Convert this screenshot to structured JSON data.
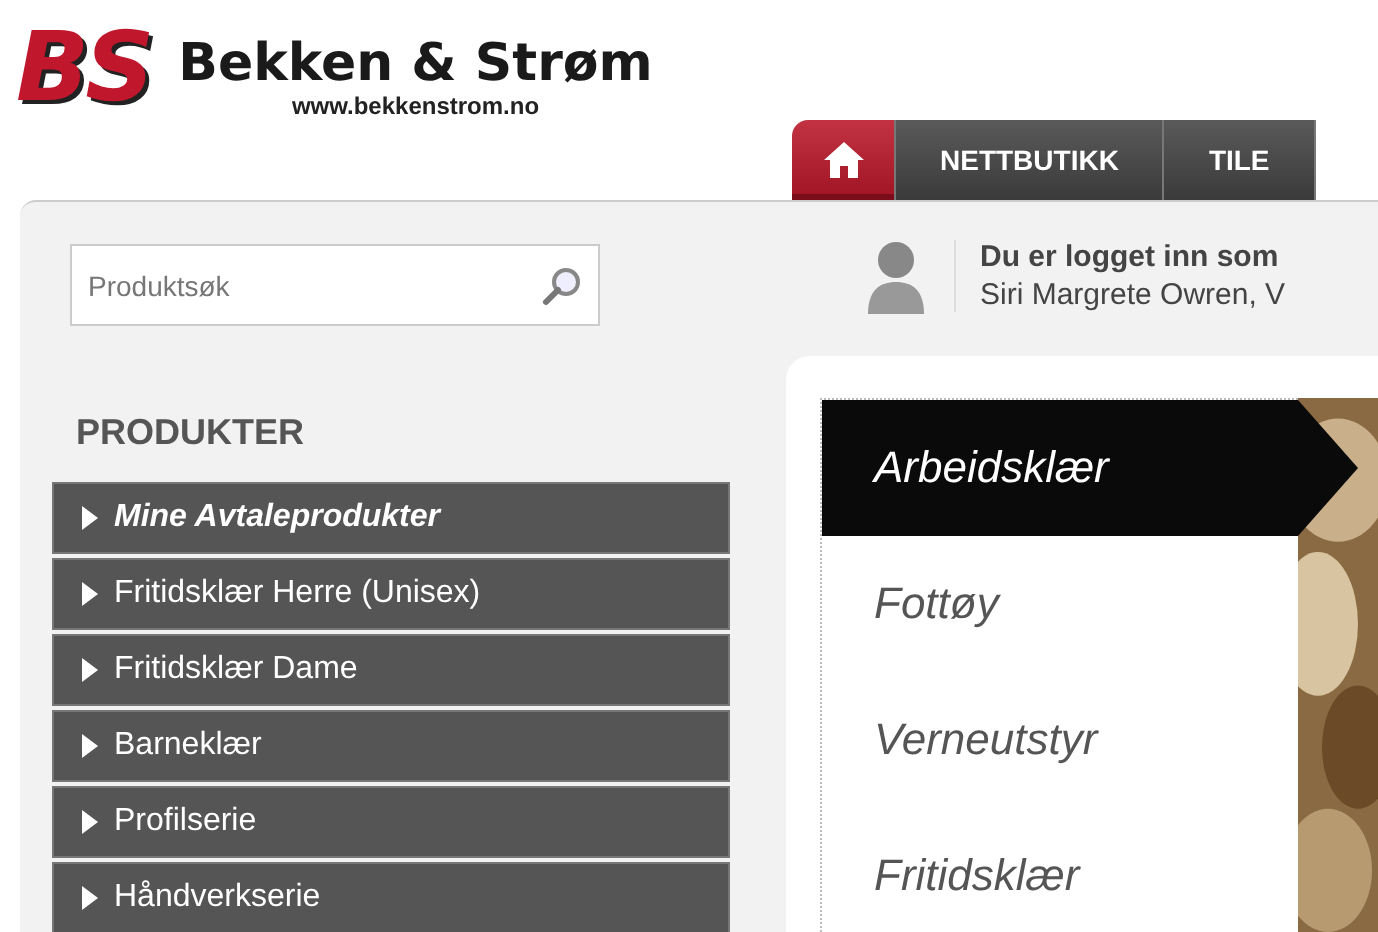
{
  "header": {
    "logo_mark": "BS",
    "brand": "Bekken & Strøm",
    "url": "www.bekkenstrom.no"
  },
  "nav_tabs": [
    {
      "kind": "home",
      "selected": true
    },
    {
      "kind": "text",
      "label": "NETTBUTIKK",
      "selected": false
    },
    {
      "kind": "text",
      "label": "TILE",
      "selected": false
    }
  ],
  "search": {
    "placeholder": "Produktsøk"
  },
  "user": {
    "status": "Du er logget inn som",
    "name": "Siri Margrete Owren, V"
  },
  "sidebar": {
    "title": "PRODUKTER",
    "items": [
      {
        "label": "Mine Avtaleprodukter",
        "featured": true
      },
      {
        "label": "Fritidsklær Herre (Unisex)",
        "featured": false
      },
      {
        "label": "Fritidsklær Dame",
        "featured": false
      },
      {
        "label": "Barneklær",
        "featured": false
      },
      {
        "label": "Profilserie",
        "featured": false
      },
      {
        "label": "Håndverkserie",
        "featured": false
      }
    ]
  },
  "categories": [
    {
      "label": "Arbeidsklær",
      "selected": true
    },
    {
      "label": "Fottøy",
      "selected": false
    },
    {
      "label": "Verneutstyr",
      "selected": false
    },
    {
      "label": "Fritidsklær",
      "selected": false
    }
  ]
}
